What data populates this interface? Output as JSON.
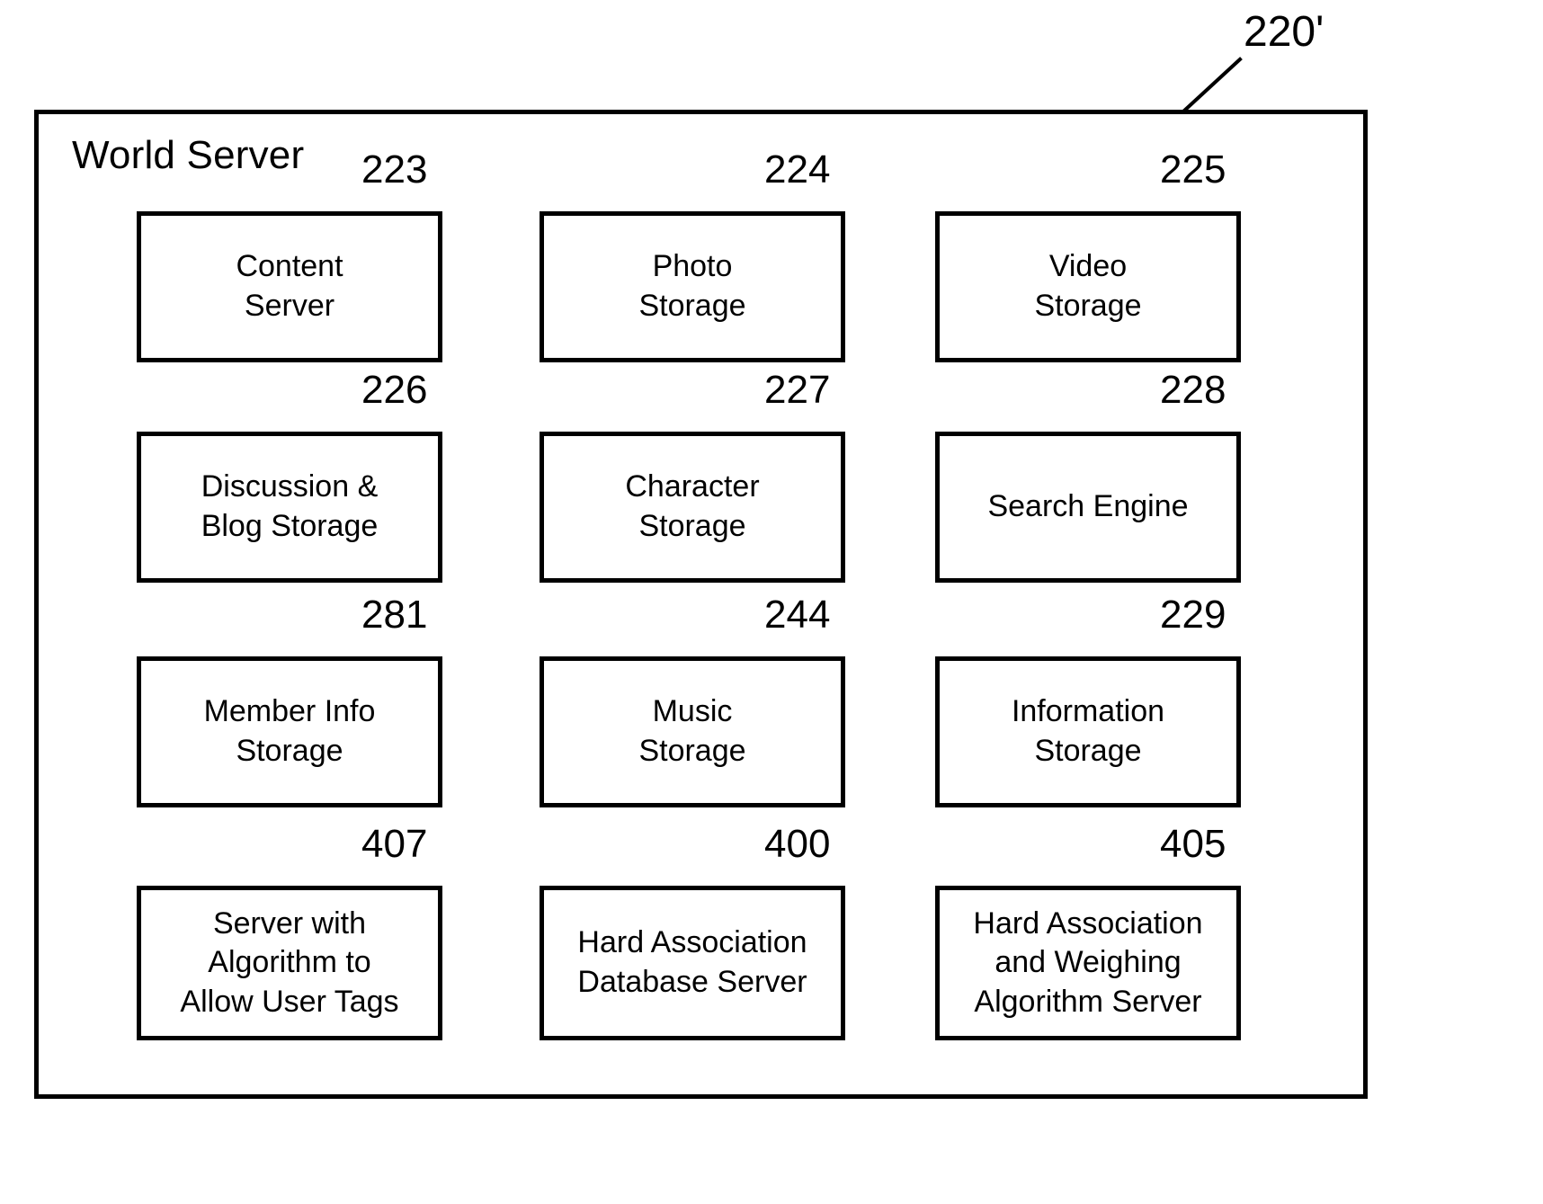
{
  "figure": {
    "top_reference": "220'",
    "title": "World Server"
  },
  "modules": [
    {
      "ref": "223",
      "label": "Content\nServer",
      "col": 0,
      "row": 0
    },
    {
      "ref": "224",
      "label": "Photo\nStorage",
      "col": 1,
      "row": 0
    },
    {
      "ref": "225",
      "label": "Video\nStorage",
      "col": 2,
      "row": 0
    },
    {
      "ref": "226",
      "label": "Discussion &\nBlog Storage",
      "col": 0,
      "row": 1
    },
    {
      "ref": "227",
      "label": "Character\nStorage",
      "col": 1,
      "row": 1
    },
    {
      "ref": "228",
      "label": "Search Engine",
      "col": 2,
      "row": 1
    },
    {
      "ref": "281",
      "label": "Member Info\nStorage",
      "col": 0,
      "row": 2
    },
    {
      "ref": "244",
      "label": "Music\nStorage",
      "col": 1,
      "row": 2
    },
    {
      "ref": "229",
      "label": "Information\nStorage",
      "col": 2,
      "row": 2
    },
    {
      "ref": "407",
      "label": "Server with\nAlgorithm to\nAllow User Tags",
      "col": 0,
      "row": 3
    },
    {
      "ref": "400",
      "label": "Hard Association\nDatabase Server",
      "col": 1,
      "row": 3
    },
    {
      "ref": "405",
      "label": "Hard Association\nand Weighing\nAlgorithm Server",
      "col": 2,
      "row": 3
    }
  ],
  "colors": {
    "stroke": "#000000",
    "background": "#ffffff",
    "text": "#000000"
  }
}
